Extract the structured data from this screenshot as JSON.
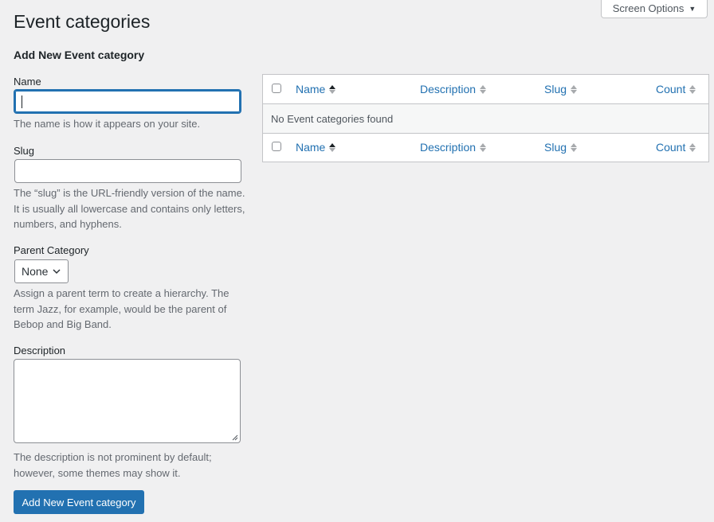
{
  "screen_options": {
    "label": "Screen Options",
    "arrow_icon": "triangle-down-icon"
  },
  "page": {
    "title": "Event categories"
  },
  "form": {
    "heading": "Add New Event category",
    "name": {
      "label": "Name",
      "value": "",
      "help": "The name is how it appears on your site."
    },
    "slug": {
      "label": "Slug",
      "value": "",
      "help": "The “slug” is the URL-friendly version of the name. It is usually all lowercase and contains only letters, numbers, and hyphens."
    },
    "parent": {
      "label": "Parent Category",
      "selected": "None",
      "help": "Assign a parent term to create a hierarchy. The term Jazz, for example, would be the parent of Bebop and Big Band."
    },
    "description": {
      "label": "Description",
      "value": "",
      "help": "The description is not prominent by default; however, some themes may show it."
    },
    "submit_label": "Add New Event category"
  },
  "table": {
    "columns": [
      {
        "label": "Name",
        "sorted": true
      },
      {
        "label": "Description",
        "sorted": false
      },
      {
        "label": "Slug",
        "sorted": false
      },
      {
        "label": "Count",
        "sorted": false
      }
    ],
    "empty_message": "No Event categories found"
  },
  "colors": {
    "accent": "#2271b1",
    "background": "#f0f0f1"
  }
}
